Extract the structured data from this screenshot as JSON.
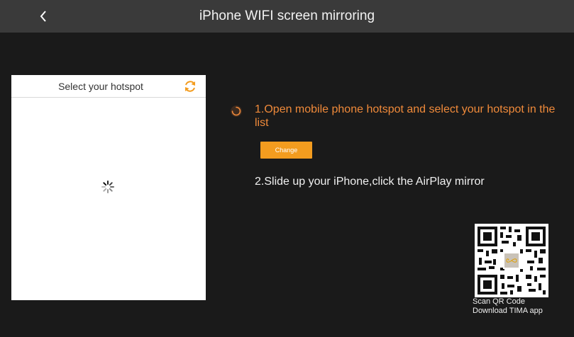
{
  "header": {
    "title": "iPhone WIFI screen mirroring",
    "back_icon": "chevron-left-icon"
  },
  "hotspot_panel": {
    "title": "Select your hotspot",
    "refresh_icon": "refresh-icon",
    "loading_icon": "spinner-icon"
  },
  "steps": {
    "step1": "1.Open mobile phone hotspot and select your hotspot in the list",
    "change_label": "Change",
    "step2": "2.Slide up your iPhone,click the AirPlay mirror"
  },
  "qr": {
    "line1": "Scan QR Code",
    "line2": "Download TIMA app"
  },
  "colors": {
    "accent": "#f08a3a",
    "button": "#f39c1f",
    "titlebar": "#3a3a3a",
    "background": "#1a1a1a"
  }
}
